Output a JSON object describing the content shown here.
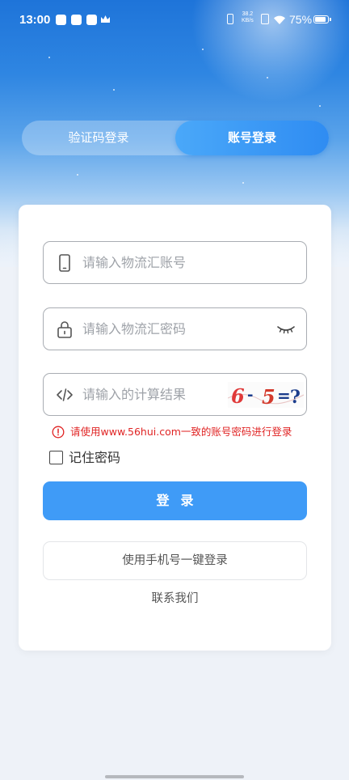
{
  "status_bar": {
    "time": "13:00",
    "net_speed_value": "38.2",
    "net_speed_unit": "KB/s",
    "battery": "75%"
  },
  "tabs": {
    "sms_login": "验证码登录",
    "account_login": "账号登录",
    "active": "account_login"
  },
  "form": {
    "account_placeholder": "请输入物流汇账号",
    "password_placeholder": "请输入物流汇密码",
    "captcha_placeholder": "请输入的计算结果",
    "captcha": {
      "chars": [
        "6",
        "-",
        "5",
        "=",
        "?"
      ],
      "colors": [
        "#e03a3a",
        "#1c3d8c",
        "#d33a2c",
        "#1c3d8c",
        "#1c3d8c"
      ]
    },
    "warning": "请使用www.56hui.com一致的账号密码进行登录",
    "remember_label": "记住密码",
    "remember_checked": false
  },
  "buttons": {
    "login": "登录",
    "phone_login": "使用手机号一键登录",
    "contact": "联系我们"
  },
  "colors": {
    "primary": "#3f9bf7",
    "warning": "#e02424"
  }
}
